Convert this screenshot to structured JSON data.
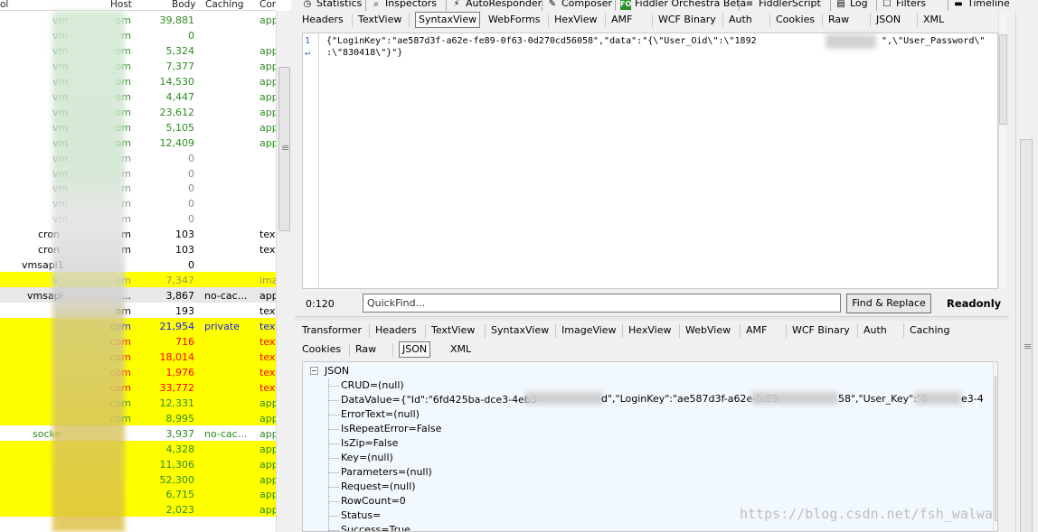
{
  "sessions": {
    "headers": {
      "col0": "ol",
      "host": "Host",
      "body": "Body",
      "caching": "Caching",
      "content": "Cor"
    },
    "rows": [
      {
        "host": "vm",
        "host2": "om",
        "body": "39,881",
        "caching": "",
        "content": "app",
        "bg": "#ffffff",
        "color": "#2e8b22"
      },
      {
        "host": "vm",
        "host2": "m",
        "body": "0",
        "caching": "",
        "content": "",
        "bg": "#ffffff",
        "color": "#2e8b22"
      },
      {
        "host": "vm",
        "host2": "om",
        "body": "5,324",
        "caching": "",
        "content": "app",
        "bg": "#ffffff",
        "color": "#2e8b22"
      },
      {
        "host": "vm",
        "host2": "om",
        "body": "7,377",
        "caching": "",
        "content": "app",
        "bg": "#ffffff",
        "color": "#2e8b22"
      },
      {
        "host": "vm",
        "host2": "om",
        "body": "14,530",
        "caching": "",
        "content": "app",
        "bg": "#ffffff",
        "color": "#2e8b22"
      },
      {
        "host": "vm",
        "host2": "om",
        "body": "4,447",
        "caching": "",
        "content": "app",
        "bg": "#ffffff",
        "color": "#2e8b22"
      },
      {
        "host": "vm",
        "host2": "om",
        "body": "23,612",
        "caching": "",
        "content": "app",
        "bg": "#ffffff",
        "color": "#2e8b22"
      },
      {
        "host": "vm",
        "host2": "om",
        "body": "5,105",
        "caching": "",
        "content": "app",
        "bg": "#ffffff",
        "color": "#2e8b22"
      },
      {
        "host": "vm",
        "host2": "om",
        "body": "12,409",
        "caching": "",
        "content": "app",
        "bg": "#ffffff",
        "color": "#2e8b22"
      },
      {
        "host": "vm",
        "host2": "m",
        "body": "0",
        "caching": "",
        "content": "",
        "bg": "#ffffff",
        "color": "#8a8a8a"
      },
      {
        "host": "vm",
        "host2": "m",
        "body": "0",
        "caching": "",
        "content": "",
        "bg": "#ffffff",
        "color": "#8a8a8a"
      },
      {
        "host": "vm",
        "host2": "m",
        "body": "0",
        "caching": "",
        "content": "",
        "bg": "#ffffff",
        "color": "#8a8a8a"
      },
      {
        "host": "vm",
        "host2": "m",
        "body": "0",
        "caching": "",
        "content": "",
        "bg": "#ffffff",
        "color": "#8a8a8a"
      },
      {
        "host": "vm",
        "host2": "m",
        "body": "0",
        "caching": "",
        "content": "",
        "bg": "#ffffff",
        "color": "#8a8a8a"
      },
      {
        "host": "cron",
        "host2": "m",
        "body": "103",
        "caching": "",
        "content": "text",
        "bg": "#ffffff",
        "color": "#000000"
      },
      {
        "host": "cron",
        "host2": "m",
        "body": "103",
        "caching": "",
        "content": "text",
        "bg": "#ffffff",
        "color": "#000000"
      },
      {
        "host": "vmsapi1",
        "host2": "",
        "body": "0",
        "caching": "",
        "content": "",
        "bg": "#ffffff",
        "color": "#000000"
      },
      {
        "host": "v",
        "host2": "om",
        "body": "7,347",
        "caching": "",
        "content": "imag",
        "bg": "#ffff00",
        "color": "#9a9a5a"
      },
      {
        "host": "vmsapi",
        "host2": "...",
        "body": "3,867",
        "caching": "no-cac...",
        "content": "app",
        "bg": "#e8e8e8",
        "color": "#000000"
      },
      {
        "host": "",
        "host2": "om",
        "body": "193",
        "caching": "",
        "content": "text",
        "bg": "#ffffff",
        "color": "#000000"
      },
      {
        "host": "",
        "host2": "com",
        "body": "21,954",
        "caching": "private",
        "content": "text",
        "bg": "#ffff00",
        "color": "#1a1aff"
      },
      {
        "host": "",
        "host2": "com",
        "body": "716",
        "caching": "",
        "content": "text",
        "bg": "#ffff00",
        "color": "#ff0000"
      },
      {
        "host": "",
        "host2": "com",
        "body": "18,014",
        "caching": "",
        "content": "text",
        "bg": "#ffff00",
        "color": "#ff0000"
      },
      {
        "host": "",
        "host2": "com",
        "body": "1,976",
        "caching": "",
        "content": "text",
        "bg": "#ffff00",
        "color": "#ff0000"
      },
      {
        "host": "",
        "host2": "com",
        "body": "33,772",
        "caching": "",
        "content": "text",
        "bg": "#ffff00",
        "color": "#ff0000"
      },
      {
        "host": "",
        "host2": "com",
        "body": "12,331",
        "caching": "",
        "content": "app",
        "bg": "#ffff00",
        "color": "#2e8b22"
      },
      {
        "host": "",
        "host2": "com",
        "body": "8,995",
        "caching": "",
        "content": "app",
        "bg": "#ffff00",
        "color": "#2e8b22"
      },
      {
        "host": "socke",
        "host2": "",
        "body": "3,937",
        "caching": "no-cac...",
        "content": "app",
        "bg": "#ffffff",
        "color": "#2e8b22"
      },
      {
        "host": "",
        "host2": "",
        "body": "4,328",
        "caching": "",
        "content": "app",
        "bg": "#ffff00",
        "color": "#2e8b22"
      },
      {
        "host": "",
        "host2": "",
        "body": "11,306",
        "caching": "",
        "content": "app",
        "bg": "#ffff00",
        "color": "#2e8b22"
      },
      {
        "host": "",
        "host2": "",
        "body": "52,300",
        "caching": "",
        "content": "app",
        "bg": "#ffff00",
        "color": "#2e8b22"
      },
      {
        "host": "",
        "host2": "",
        "body": "6,715",
        "caching": "",
        "content": "app",
        "bg": "#ffff00",
        "color": "#2e8b22"
      },
      {
        "host": "",
        "host2": "",
        "body": "2,023",
        "caching": "",
        "content": "app",
        "bg": "#ffff00",
        "color": "#2e8b22"
      }
    ]
  },
  "top_tabs": [
    {
      "label": "Statistics",
      "icon": "clock-icon",
      "glyph": "◷"
    },
    {
      "label": "Inspectors",
      "icon": "inspector-icon",
      "glyph": "⌕"
    },
    {
      "label": "AutoResponder",
      "icon": "lightning-icon",
      "glyph": "⚡"
    },
    {
      "label": "Composer",
      "icon": "composer-icon",
      "glyph": "✎"
    },
    {
      "label": "Fiddler Orchestra Beta",
      "icon": "fo-icon",
      "glyph": "FO"
    },
    {
      "label": "FiddlerScript",
      "icon": "script-icon",
      "glyph": "≡"
    },
    {
      "label": "Log",
      "icon": "log-icon",
      "glyph": "▤"
    },
    {
      "label": "Filters",
      "icon": "filters-checkbox-icon",
      "glyph": "☐"
    },
    {
      "label": "Timeline",
      "icon": "timeline-icon",
      "glyph": "▬"
    }
  ],
  "request_tabs": [
    "Headers",
    "TextView",
    "SyntaxView",
    "WebForms",
    "HexView",
    "AMF",
    "WCF Binary",
    "Auth",
    "Cookies",
    "Raw",
    "JSON",
    "XML"
  ],
  "editor": {
    "line1": "{\"LoginKey\":\"ae587d3f-a62e-fe89-0f63-0d270cd56058\",\"data\":\"{\\\"User_Oid\\\":\\\"1892",
    "line1b": "\",\\\"User_Password\\\"",
    "line2": ":\\\"830418\\\"}\"}",
    "line_number": "1",
    "wrap_glyph": "↵"
  },
  "findbar": {
    "position": "0:120",
    "placeholder": "QuickFind...",
    "button": "Find & Replace",
    "status": "Readonly"
  },
  "response_tabs_row1": [
    "Transformer",
    "Headers",
    "TextView",
    "SyntaxView",
    "ImageView",
    "HexView",
    "WebView",
    "AMF",
    "WCF Binary",
    "Auth",
    "Caching"
  ],
  "response_tabs_row2": [
    "Cookies",
    "Raw",
    "JSON",
    "XML"
  ],
  "json_tree": {
    "root": "JSON",
    "nodes": [
      "CRUD=(null)",
      "DataValue={\"Id\":\"6fd425ba-dce3-4eb3-",
      "ErrorText=(null)",
      "IsRepeatError=False",
      "IsZip=False",
      "Key=(null)",
      "Parameters=(null)",
      "Request=(null)",
      "RowCount=0",
      "Status=",
      "Success=True"
    ],
    "datavalue_tail1": "d\",\"LoginKey\":\"ae587d3f-a62e-fe89-",
    "datavalue_tail2": "58\",\"User_Key\":\"6",
    "datavalue_tail3": "e3-4"
  },
  "watermark": "https://blog.csdn.net/fsh_walwa"
}
